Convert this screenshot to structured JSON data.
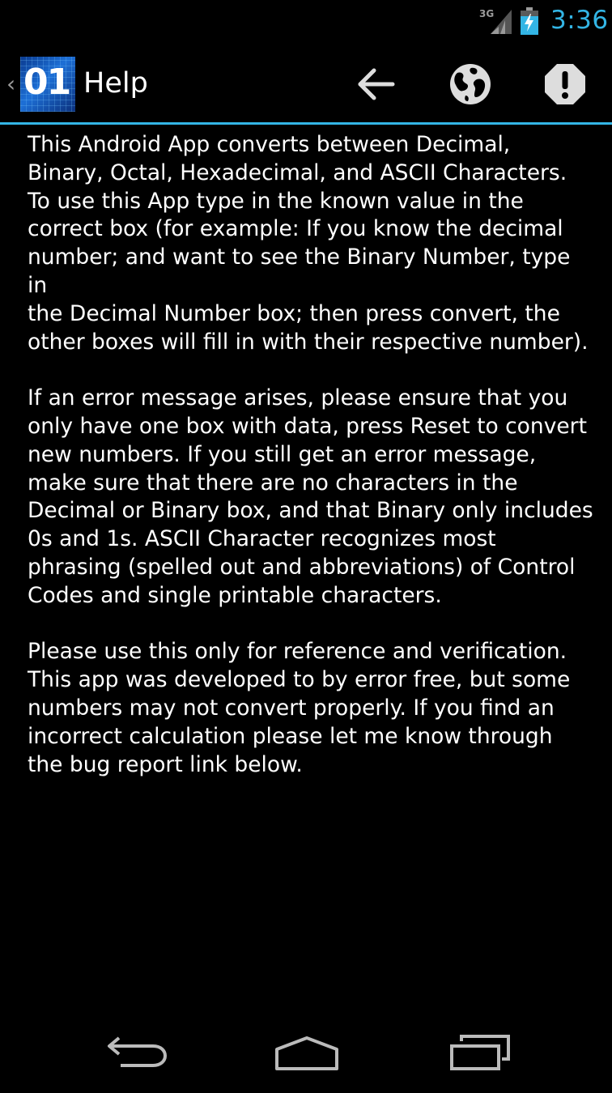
{
  "status_bar": {
    "network_label": "3G",
    "time": "3:36",
    "accent_color": "#33b5e5"
  },
  "action_bar": {
    "app_icon_text": "01",
    "title": "Help",
    "actions": [
      {
        "icon": "arrow-left-icon"
      },
      {
        "icon": "globe-icon"
      },
      {
        "icon": "alert-icon"
      }
    ]
  },
  "content": {
    "paragraphs": [
      "This Android App converts between Decimal,\nBinary, Octal, Hexadecimal, and ASCII Characters.\nTo use this App type in the known value in the\ncorrect box (for example: If you know the decimal\nnumber; and want to see the Binary Number, type in\nthe Decimal Number box; then press convert, the\nother boxes will fill in with their respective number).",
      "If an error message arises, please ensure that you\nonly have one box with data, press Reset to convert\nnew numbers. If you still get an error message,\nmake sure that there are no characters in the\nDecimal or Binary box, and that Binary only includes\n0s and 1s. ASCII Character recognizes most\nphrasing (spelled out and abbreviations) of Control\nCodes and single printable characters.",
      "Please use this only for reference and verification.\nThis app was developed to by error free, but some\nnumbers may not convert properly.  If you find an\nincorrect calculation please let me know through\nthe bug report link below."
    ]
  },
  "nav_bar": {
    "buttons": [
      {
        "icon": "back-icon"
      },
      {
        "icon": "home-icon"
      },
      {
        "icon": "recent-apps-icon"
      }
    ]
  }
}
